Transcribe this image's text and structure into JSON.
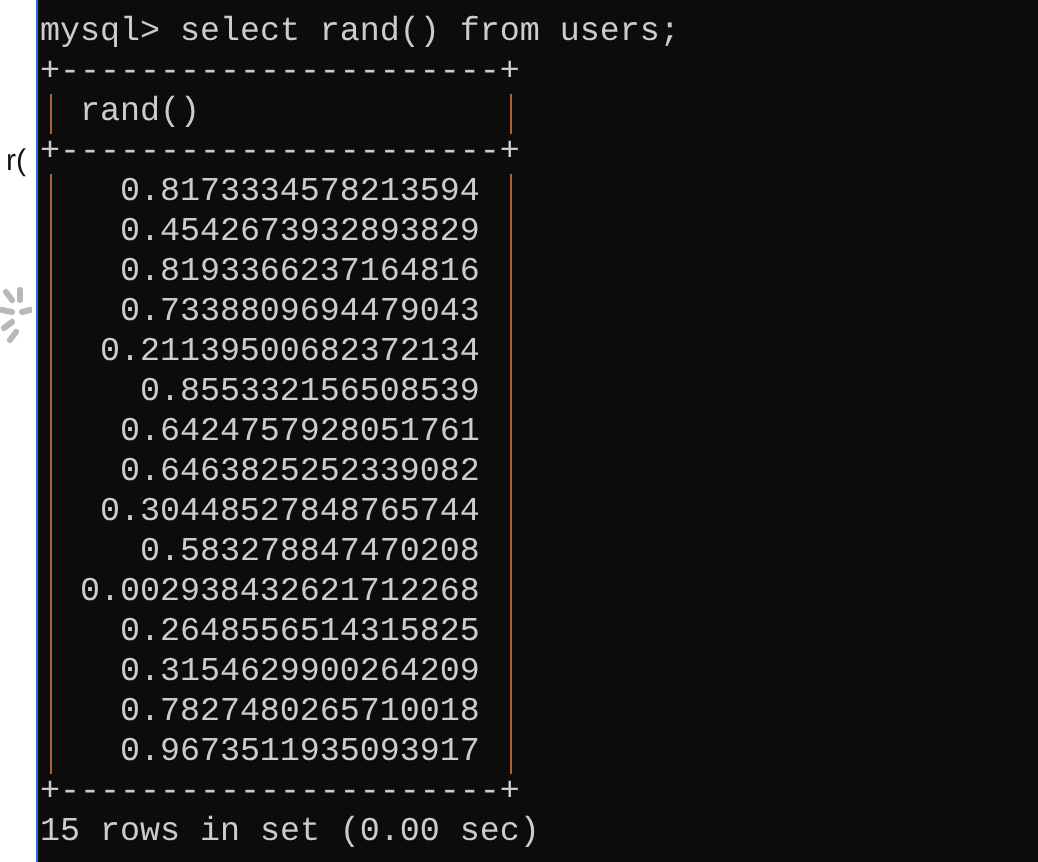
{
  "background_window": {
    "text": "r("
  },
  "terminal": {
    "command_line": "mysql> select rand() from users;",
    "table": {
      "border_top": "+----------------------+",
      "column": "rand()",
      "border_mid": "+----------------------+",
      "rows": [
        "0.8173334578213594",
        "0.4542673932893829",
        "0.8193366237164816",
        "0.7338809694479043",
        "0.21139500682372134",
        "0.855332156508539",
        "0.6424757928051761",
        "0.6463825252339082",
        "0.30448527848765744",
        "0.583278847470208",
        "0.002938432621712268",
        "0.2648556514315825",
        "0.3154629900264209",
        "0.7827480265710018",
        "0.9673511935093917"
      ],
      "border_bottom": "+----------------------+"
    },
    "footer": "15 rows in set (0.00 sec)"
  }
}
